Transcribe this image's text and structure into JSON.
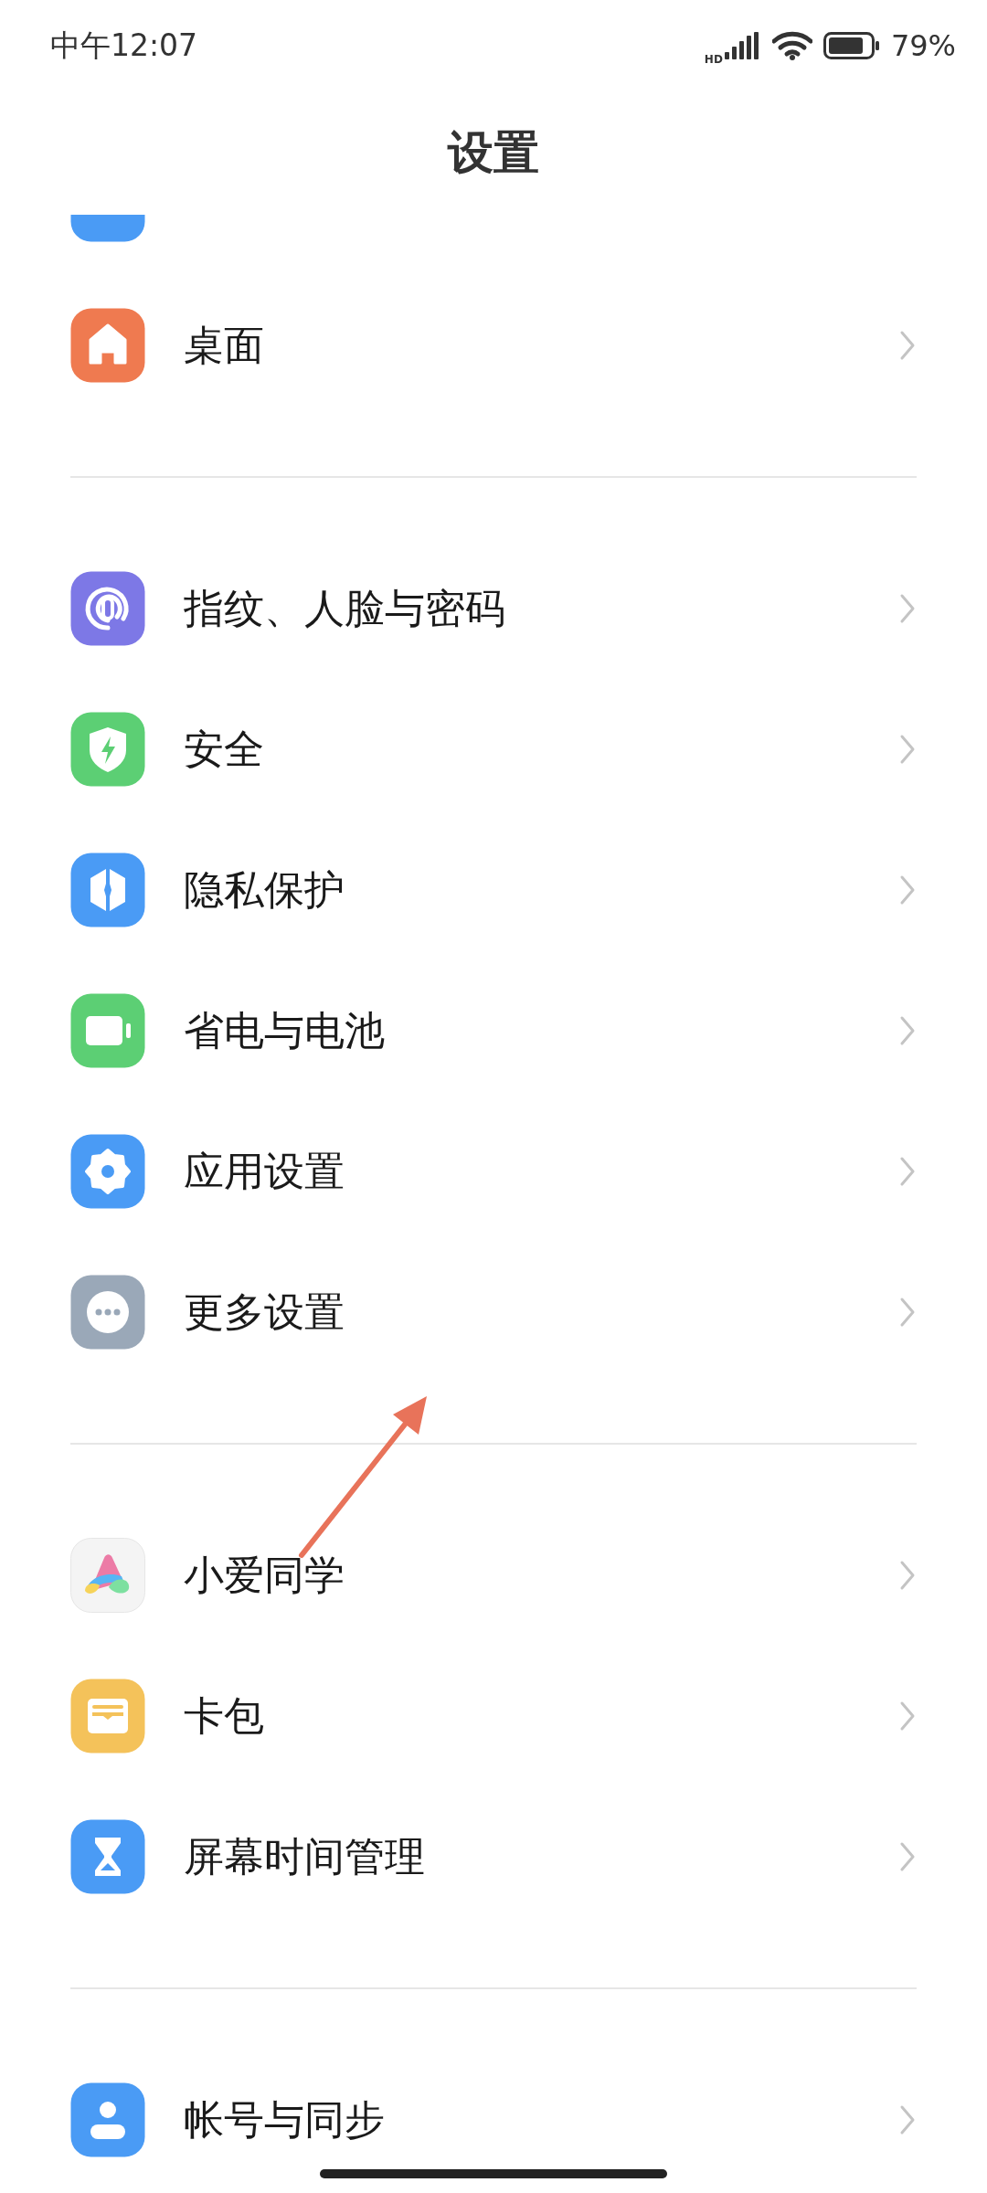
{
  "status_bar": {
    "time": "中午12:07",
    "network_label": "HD",
    "battery_text": "79%"
  },
  "header": {
    "title": "设置"
  },
  "clipped_item": {
    "kind": "notification"
  },
  "groups": [
    {
      "items": [
        {
          "label": "桌面",
          "kind": "home"
        }
      ]
    },
    {
      "items": [
        {
          "label": "指纹、人脸与密码",
          "kind": "fingerprint"
        },
        {
          "label": "安全",
          "kind": "shield"
        },
        {
          "label": "隐私保护",
          "kind": "privacy"
        },
        {
          "label": "省电与电池",
          "kind": "battery"
        },
        {
          "label": "应用设置",
          "kind": "gear"
        },
        {
          "label": "更多设置",
          "kind": "more"
        }
      ]
    },
    {
      "items": [
        {
          "label": "小爱同学",
          "kind": "assistant"
        },
        {
          "label": "卡包",
          "kind": "wallet"
        },
        {
          "label": "屏幕时间管理",
          "kind": "hourglass"
        }
      ]
    },
    {
      "items": [
        {
          "label": "帐号与同步",
          "kind": "account"
        }
      ]
    }
  ],
  "annotation": {
    "kind": "arrow"
  }
}
